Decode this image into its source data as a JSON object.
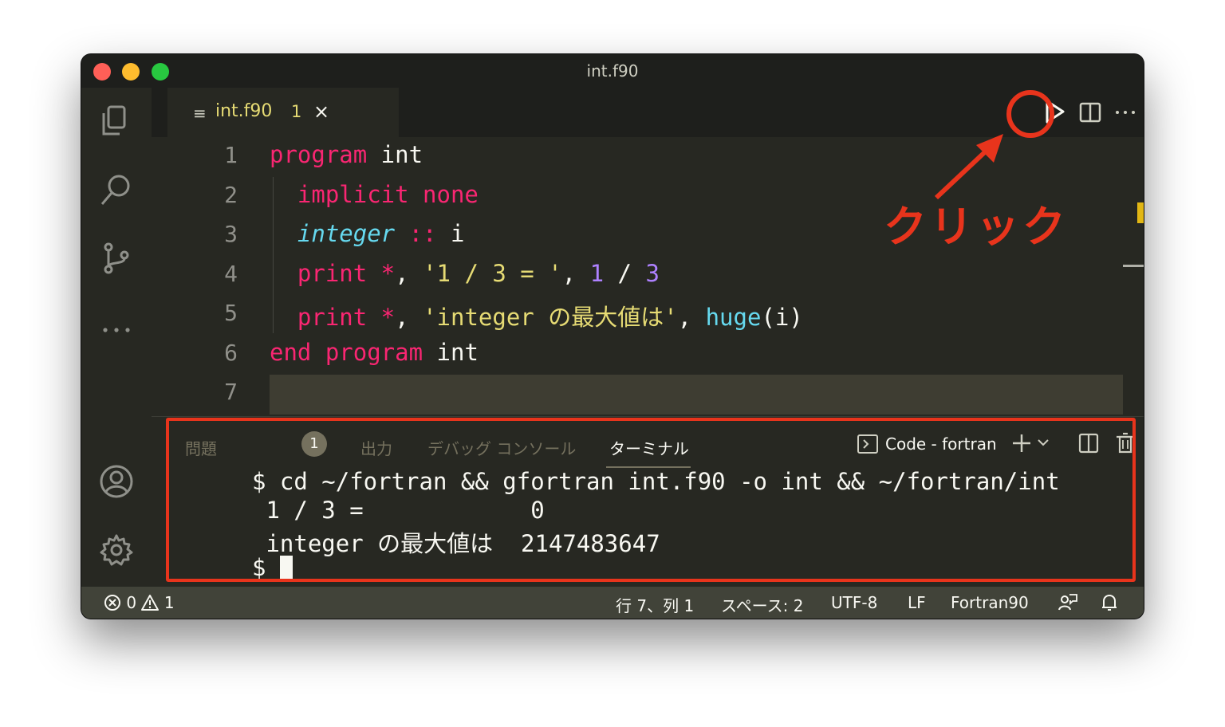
{
  "window": {
    "title": "int.f90"
  },
  "tab": {
    "icon": "lines-icon",
    "name": "int.f90",
    "problem_count": "1",
    "close": "×"
  },
  "editor": {
    "line_numbers": [
      "1",
      "2",
      "3",
      "4",
      "5",
      "6",
      "7"
    ],
    "lines": [
      [
        {
          "t": "program",
          "c": "kw"
        },
        {
          "t": " int",
          "c": ""
        }
      ],
      [
        {
          "t": "  implicit none",
          "c": "kw"
        }
      ],
      [
        {
          "t": "  integer",
          "c": "typ"
        },
        {
          "t": " ::",
          "c": "kw"
        },
        {
          "t": " i",
          "c": ""
        }
      ],
      [
        {
          "t": "  print",
          "c": "kw"
        },
        {
          "t": " *",
          "c": "kw"
        },
        {
          "t": ", ",
          "c": ""
        },
        {
          "t": "'1 / 3 = '",
          "c": "str"
        },
        {
          "t": ", ",
          "c": ""
        },
        {
          "t": "1",
          "c": "num"
        },
        {
          "t": " / ",
          "c": ""
        },
        {
          "t": "3",
          "c": "num"
        }
      ],
      [
        {
          "t": "  print",
          "c": "kw"
        },
        {
          "t": " *",
          "c": "kw"
        },
        {
          "t": ", ",
          "c": ""
        },
        {
          "t": "'integer の最大値は'",
          "c": "str"
        },
        {
          "t": ", ",
          "c": ""
        },
        {
          "t": "huge",
          "c": "fn"
        },
        {
          "t": "(i)",
          "c": ""
        }
      ],
      [
        {
          "t": "end program",
          "c": "kw"
        },
        {
          "t": " int",
          "c": ""
        }
      ],
      []
    ]
  },
  "panel": {
    "tabs": [
      "問題",
      "出力",
      "デバッグ コンソール",
      "ターミナル"
    ],
    "problems_badge": "1",
    "terminal_name": "Code - fortran",
    "terminal_lines": [
      "$ cd ~/fortran && gfortran int.f90 -o int && ~/fortran/int",
      " 1 / 3 =            0",
      " integer の最大値は  2147483647",
      "$ "
    ]
  },
  "statusbar": {
    "errors": "0",
    "warnings": "1",
    "position": "行 7、列 1",
    "spaces": "スペース: 2",
    "encoding": "UTF-8",
    "eol": "LF",
    "language": "Fortran90"
  },
  "annotation": {
    "text": "クリック",
    "color": "#e8341c"
  },
  "colors": {
    "keyword": "#f92672",
    "type": "#66d9ef",
    "string": "#e6db74",
    "number": "#ae81ff",
    "accent": "#e8341c"
  }
}
